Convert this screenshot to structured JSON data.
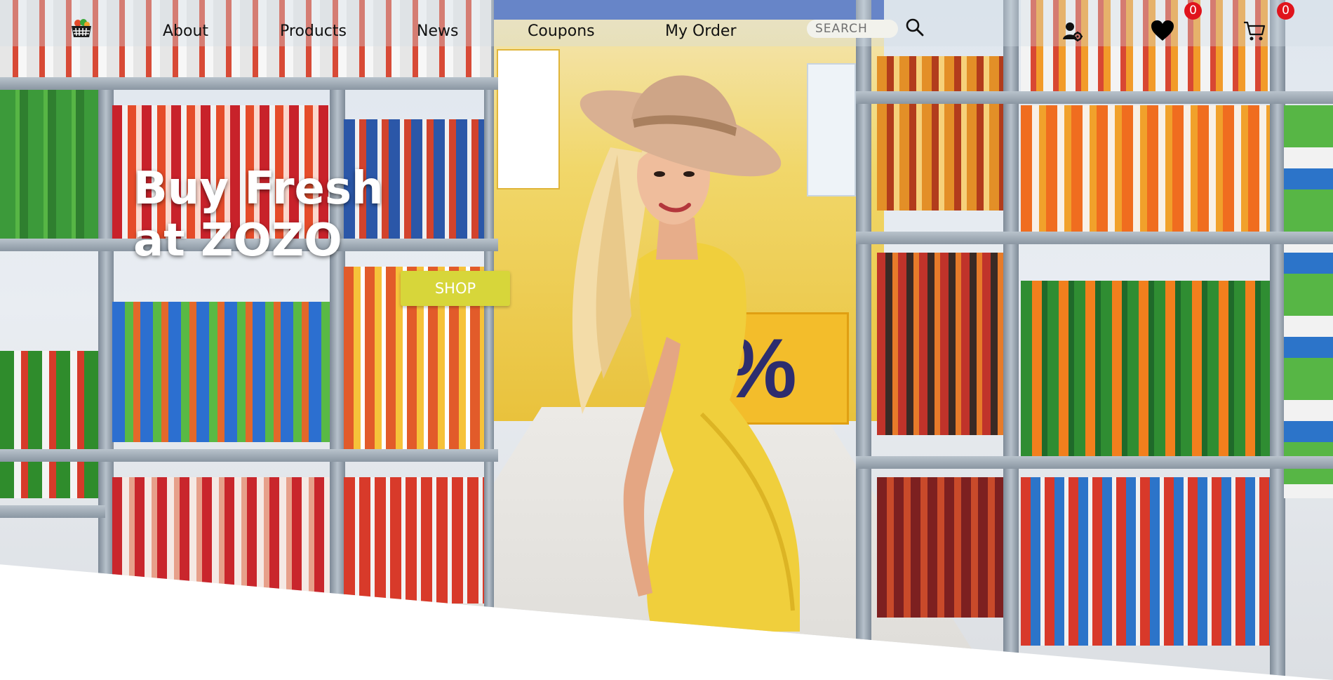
{
  "header": {
    "logo_icon": "shopping-basket-icon",
    "nav": [
      {
        "label": "About"
      },
      {
        "label": "Products"
      },
      {
        "label": "News"
      },
      {
        "label": "Coupons"
      },
      {
        "label": "My Order"
      }
    ],
    "search": {
      "placeholder": "SEARCH",
      "icon": "search-icon"
    },
    "account_icon": "user-settings-icon",
    "wishlist": {
      "icon": "heart-icon",
      "count": "0"
    },
    "cart": {
      "icon": "cart-icon",
      "count": "0"
    }
  },
  "hero": {
    "headline_line1": "Buy Fresh",
    "headline_line2": "at ZOZO",
    "cta_label": "SHOP",
    "promo_sign": "%"
  },
  "colors": {
    "cta": "#d7d63a",
    "badge": "#e0141c",
    "headline": "#ffffff",
    "nav_text": "#111111"
  }
}
